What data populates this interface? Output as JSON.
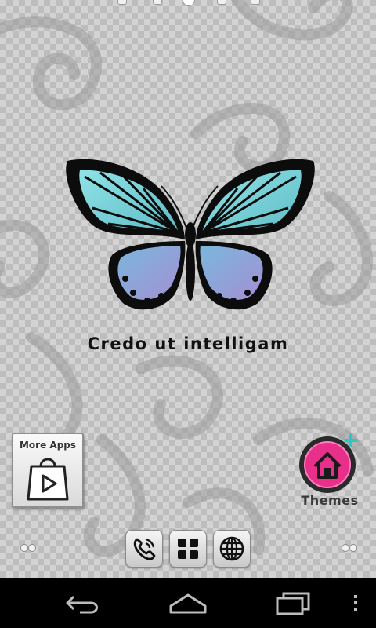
{
  "wallpaper": {
    "motto": "Credo ut intelligam"
  },
  "page_indicator": {
    "pages": 5,
    "active_index": 2
  },
  "more_apps": {
    "label": "More Apps",
    "icon": "shopping-bag-play-icon"
  },
  "themes": {
    "label": "Themes",
    "icon": "home-plus-icon",
    "accent_color": "#e8308a",
    "plus_color": "#2ec6c8"
  },
  "dock": {
    "items": [
      {
        "name": "phone",
        "icon": "phone-icon"
      },
      {
        "name": "app-drawer",
        "icon": "grid-icon"
      },
      {
        "name": "browser",
        "icon": "globe-icon"
      }
    ]
  },
  "navbar": {
    "buttons": [
      {
        "name": "back",
        "icon": "back-arrow-icon"
      },
      {
        "name": "home",
        "icon": "home-outline-icon"
      },
      {
        "name": "recents",
        "icon": "recent-apps-icon"
      },
      {
        "name": "menu",
        "icon": "overflow-menu-icon"
      }
    ]
  },
  "colors": {
    "butterfly_upper_wing": "#77d4d8",
    "butterfly_lower_wing": "#8f96d6",
    "nav_icon": "#bdbdbd"
  }
}
